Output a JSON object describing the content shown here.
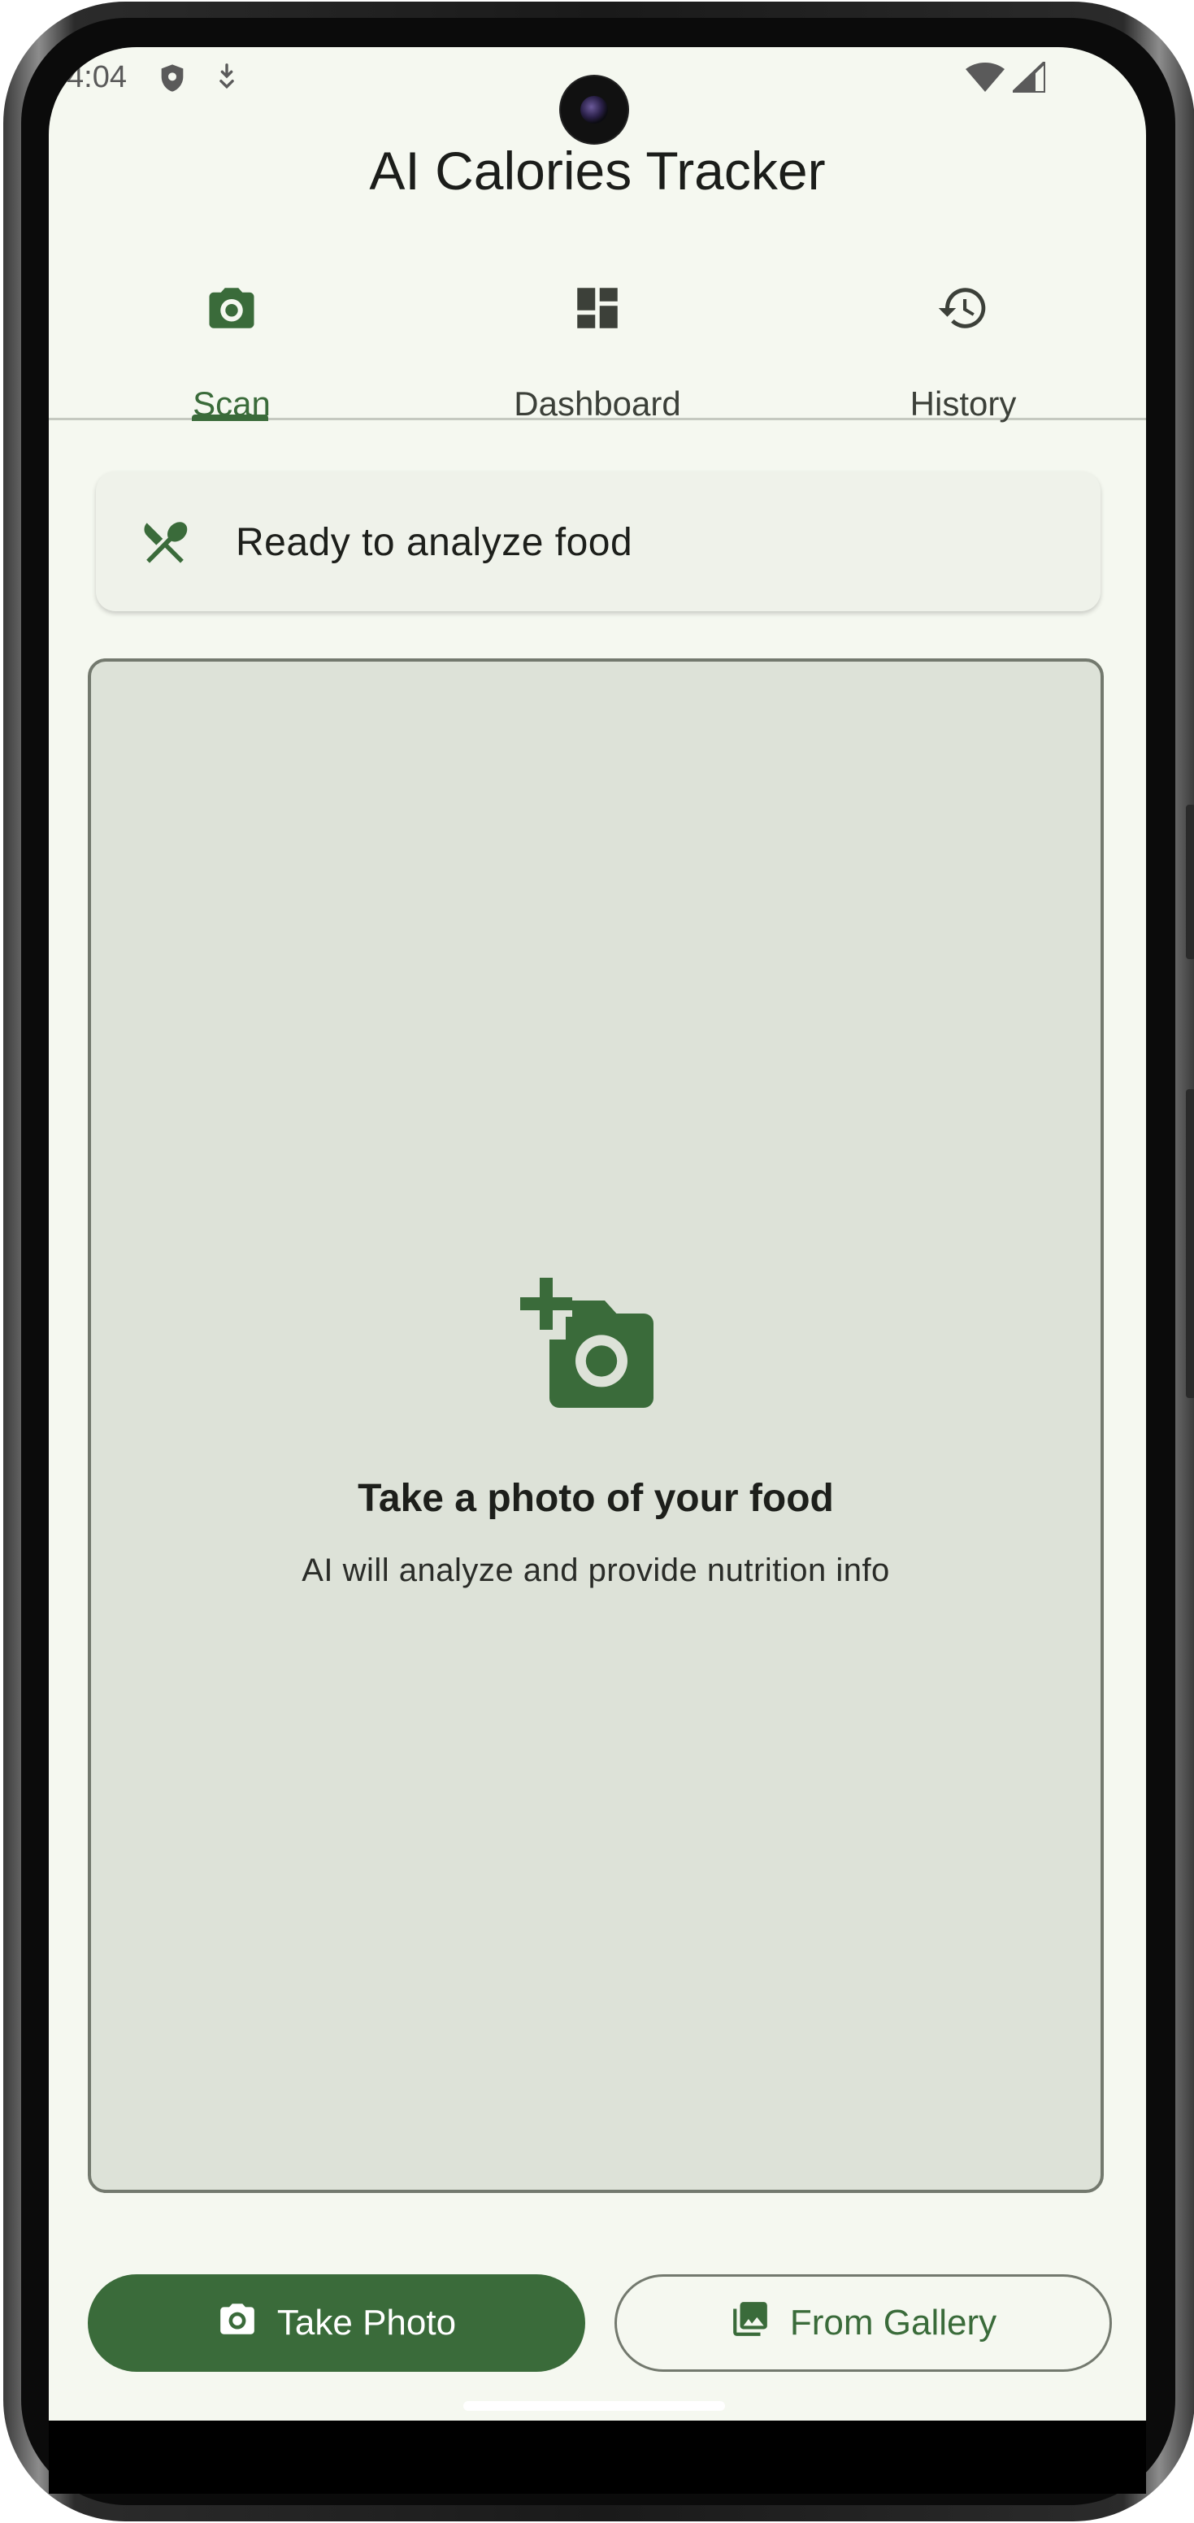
{
  "status_bar": {
    "time": "4:04",
    "icons": [
      "shield-icon",
      "download-icon",
      "wifi-icon",
      "signal-icon"
    ]
  },
  "app": {
    "title": "AI Calories Tracker"
  },
  "tabs": [
    {
      "label": "Scan",
      "icon": "camera-icon",
      "active": true
    },
    {
      "label": "Dashboard",
      "icon": "dashboard-icon",
      "active": false
    },
    {
      "label": "History",
      "icon": "history-icon",
      "active": false
    }
  ],
  "status_card": {
    "icon": "restaurant-icon",
    "text": "Ready to analyze food"
  },
  "placeholder": {
    "icon": "add-a-photo-icon",
    "title": "Take a photo of your food",
    "subtitle": "AI will analyze and provide nutrition info"
  },
  "actions": {
    "take_photo": "Take Photo",
    "from_gallery": "From Gallery"
  },
  "colors": {
    "primary": "#3a6b3a",
    "background": "#f5f8f0",
    "surface_variant": "#dde2d8",
    "outline": "#73796e"
  }
}
